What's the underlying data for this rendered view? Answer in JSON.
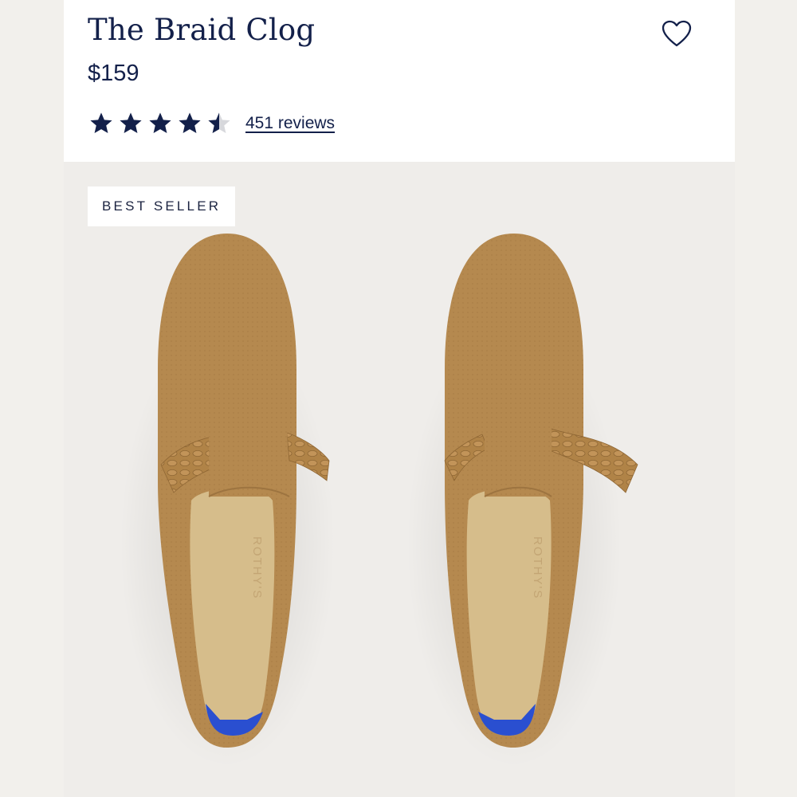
{
  "product": {
    "title": "The Braid Clog",
    "price": "$159",
    "rating": 4.5,
    "rating_max": 5,
    "reviews_label": "451 reviews",
    "badge": "BEST SELLER",
    "insole_brand": "ROTHY'S",
    "image_alt": "The Braid Clog pair in tan knit with braided strap"
  },
  "icons": {
    "favorite": "heart-outline-icon",
    "star": "star-icon"
  },
  "colors": {
    "text": "#13204a",
    "star": "#13204a",
    "clog_knit": "#b5894f",
    "insole": "#d6bd8b",
    "heel_accent": "#2a4fd0"
  }
}
